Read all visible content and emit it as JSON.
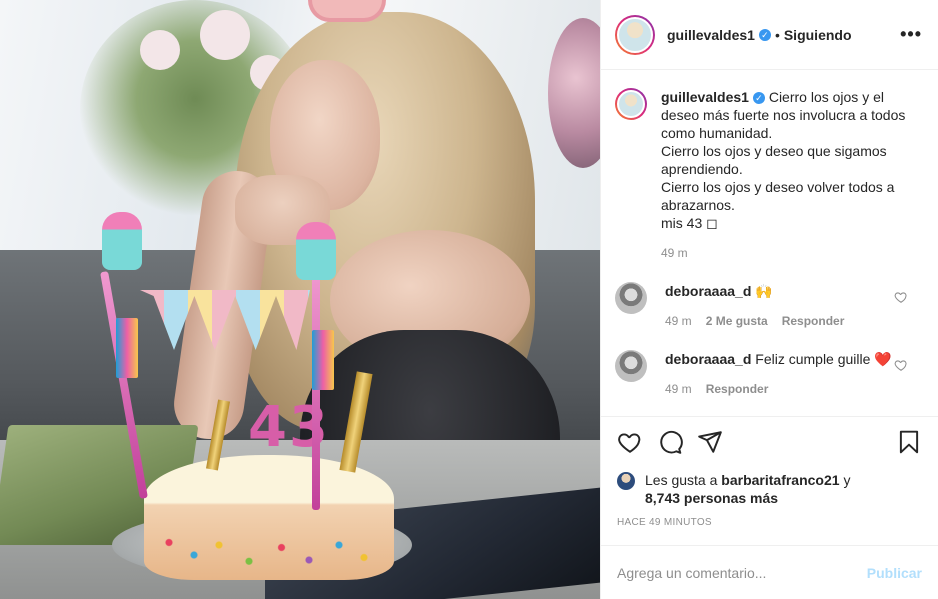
{
  "post": {
    "author": "guillevaldes1",
    "follow_status": "Siguiendo",
    "more_label": "•••",
    "photo_alt": "",
    "cake_number": "43"
  },
  "caption": {
    "username": "guillevaldes1",
    "lines": [
      "Cierro los ojos y el deseo más fuerte nos involucra a todos como humanidad.",
      "Cierro los ojos y deseo que sigamos aprendiendo.",
      "Cierro los ojos y deseo volver todos a abrazarnos.",
      "mis 43 ◻"
    ],
    "time": "49 m"
  },
  "comments": [
    {
      "username": "deboraaaa_d",
      "text": "🙌",
      "time": "49 m",
      "likes": "2 Me gusta",
      "reply": "Responder"
    },
    {
      "username": "deboraaaa_d",
      "text": "Feliz cumple guille ❤️",
      "time": "49 m",
      "likes": "",
      "reply": "Responder"
    }
  ],
  "actions": {
    "icons": [
      "heart-icon",
      "comment-icon",
      "share-icon",
      "bookmark-icon"
    ],
    "likes_prefix": "Les gusta a ",
    "likes_user": "barbaritafranco21",
    "likes_joiner": " y",
    "likes_count": "8,743 personas más",
    "posted_ago": "HACE 49 MINUTOS"
  },
  "composer": {
    "placeholder": "Agrega un comentario...",
    "submit": "Publicar"
  },
  "colors": {
    "text": "#262626",
    "secondary": "#8e8e8e",
    "verified": "#3897f0",
    "publish_disabled": "#b2dffc",
    "divider": "#efefef",
    "liked_heart": "#ed4956"
  }
}
